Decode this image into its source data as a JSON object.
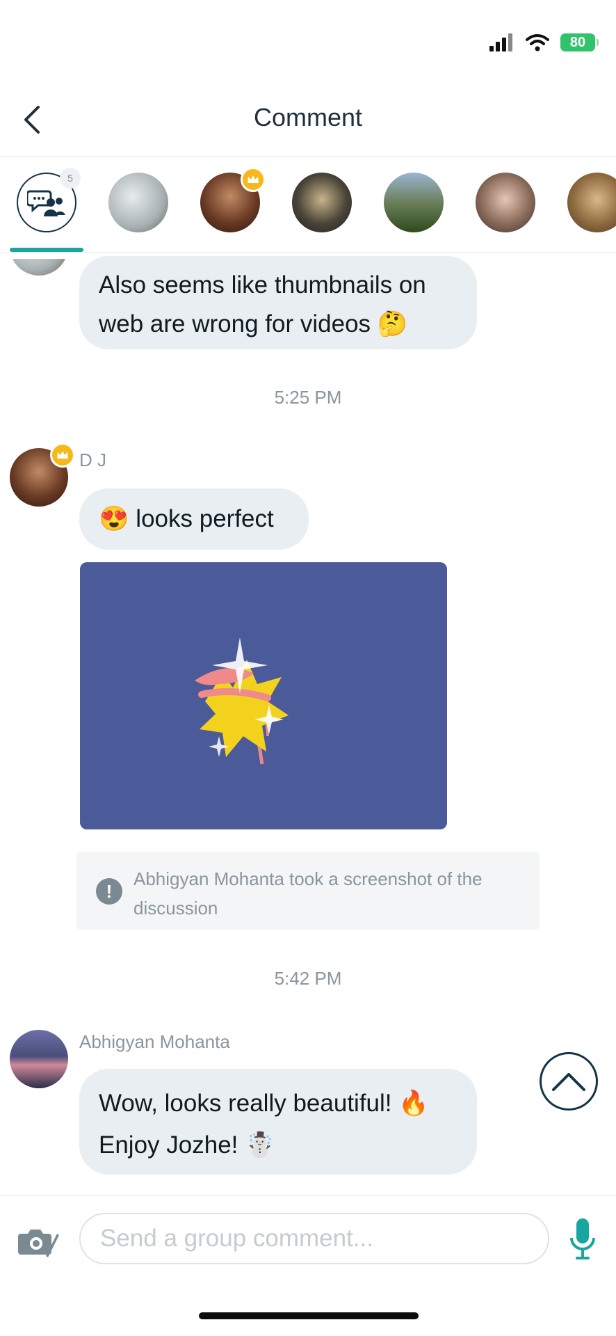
{
  "status_bar": {
    "battery": "80"
  },
  "header": {
    "title": "Comment"
  },
  "participants": {
    "group_count": "5",
    "avatars": [
      "user-avatar-1",
      "user-avatar-2",
      "user-avatar-3",
      "user-avatar-4",
      "user-avatar-5",
      "user-avatar-6"
    ]
  },
  "messages": {
    "first": {
      "text": "Also seems like thumbnails on web are wrong for videos 🤔"
    },
    "time_1": "5:25 PM",
    "dj": {
      "sender": "D J",
      "text": "😍 looks perfect"
    },
    "notice": "Abhigyan Mohanta took a screenshot of the discussion",
    "time_2": "5:42 PM",
    "abhigyan": {
      "sender": "Abhigyan Mohanta",
      "line1": "Wow, looks really beautiful! 🔥",
      "line2": "Enjoy Jozhe! ☃️"
    }
  },
  "composer": {
    "placeholder": "Send a group comment..."
  },
  "colors": {
    "accent": "#1aa6a0",
    "bubble": "#e8eef2",
    "crown": "#f6b81b",
    "dark": "#143445"
  }
}
